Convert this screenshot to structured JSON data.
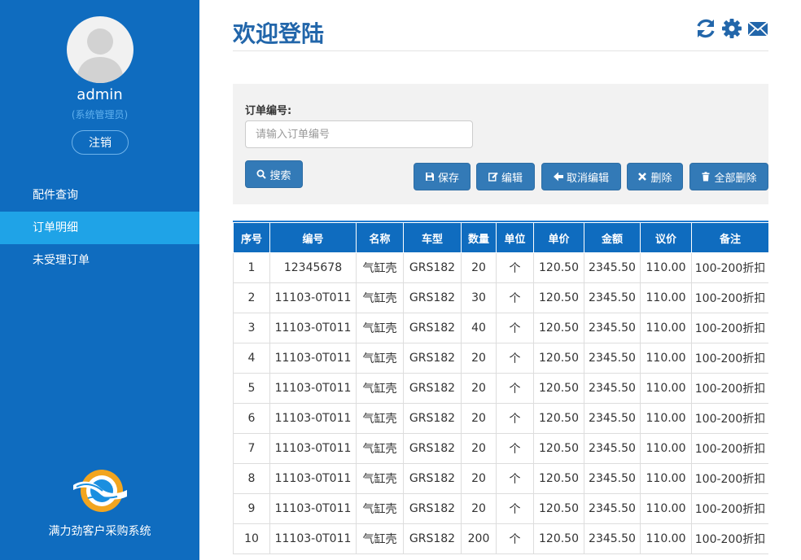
{
  "sidebar": {
    "username": "admin",
    "role": "(系统管理员)",
    "logout_label": "注销",
    "nav": [
      {
        "label": "配件查询",
        "active": false
      },
      {
        "label": "订单明细",
        "active": true
      },
      {
        "label": "未受理订单",
        "active": false
      }
    ],
    "brand_name": "满力劲客户采购系统"
  },
  "header": {
    "title": "欢迎登陆",
    "icons": [
      "refresh-icon",
      "gear-icon",
      "mail-icon"
    ]
  },
  "search": {
    "label": "订单编号:",
    "value": "",
    "placeholder": "请输入订单编号",
    "search_label": "搜索"
  },
  "actions": {
    "save": "保存",
    "edit": "编辑",
    "cancel_edit": "取消编辑",
    "delete": "删除",
    "delete_all": "全部删除"
  },
  "table": {
    "columns": [
      "序号",
      "编号",
      "名称",
      "车型",
      "数量",
      "单位",
      "单价",
      "金额",
      "议价",
      "备注"
    ],
    "rows": [
      [
        "1",
        "12345678",
        "气缸壳",
        "GRS182",
        "20",
        "个",
        "120.50",
        "2345.50",
        "110.00",
        "100-200折扣"
      ],
      [
        "2",
        "11103-0T011",
        "气缸壳",
        "GRS182",
        "30",
        "个",
        "120.50",
        "2345.50",
        "110.00",
        "100-200折扣"
      ],
      [
        "3",
        "11103-0T011",
        "气缸壳",
        "GRS182",
        "40",
        "个",
        "120.50",
        "2345.50",
        "110.00",
        "100-200折扣"
      ],
      [
        "4",
        "11103-0T011",
        "气缸壳",
        "GRS182",
        "20",
        "个",
        "120.50",
        "2345.50",
        "110.00",
        "100-200折扣"
      ],
      [
        "5",
        "11103-0T011",
        "气缸壳",
        "GRS182",
        "20",
        "个",
        "120.50",
        "2345.50",
        "110.00",
        "100-200折扣"
      ],
      [
        "6",
        "11103-0T011",
        "气缸壳",
        "GRS182",
        "20",
        "个",
        "120.50",
        "2345.50",
        "110.00",
        "100-200折扣"
      ],
      [
        "7",
        "11103-0T011",
        "气缸壳",
        "GRS182",
        "20",
        "个",
        "120.50",
        "2345.50",
        "110.00",
        "100-200折扣"
      ],
      [
        "8",
        "11103-0T011",
        "气缸壳",
        "GRS182",
        "20",
        "个",
        "120.50",
        "2345.50",
        "110.00",
        "100-200折扣"
      ],
      [
        "9",
        "11103-0T011",
        "气缸壳",
        "GRS182",
        "20",
        "个",
        "120.50",
        "2345.50",
        "110.00",
        "100-200折扣"
      ],
      [
        "10",
        "11103-0T011",
        "气缸壳",
        "GRS182",
        "200",
        "个",
        "120.50",
        "2345.50",
        "110.00",
        "100-200折扣"
      ]
    ]
  },
  "colors": {
    "sidebar_bg": "#0f6cbf",
    "nav_active_bg": "#1fa3e7",
    "title": "#2266aa",
    "button": "#337ab7"
  }
}
